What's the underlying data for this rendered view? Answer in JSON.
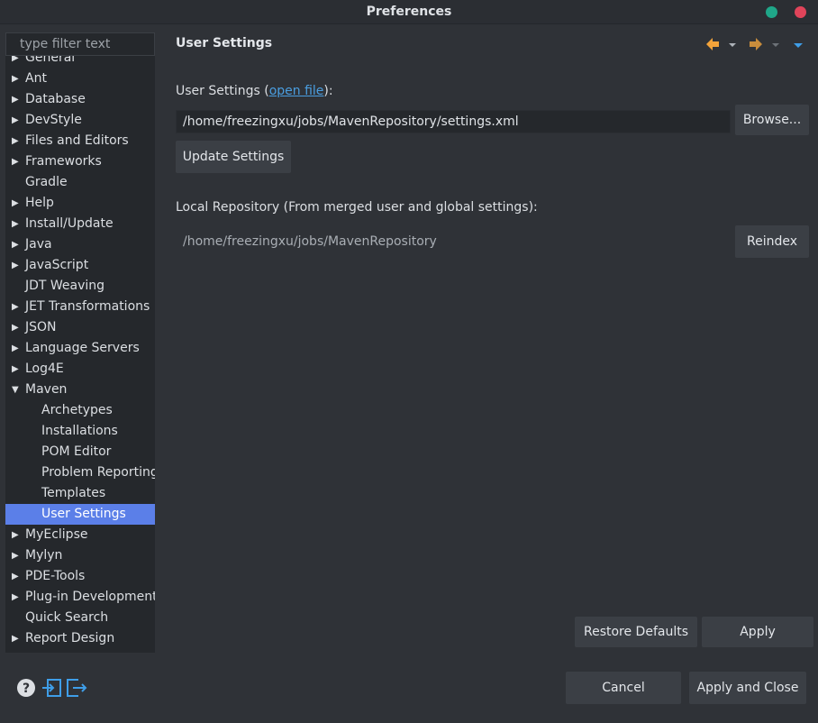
{
  "window": {
    "title": "Preferences"
  },
  "filter": {
    "placeholder": "type filter text"
  },
  "tree": [
    {
      "label": "General",
      "arrow": "▶",
      "child": false
    },
    {
      "label": "Ant",
      "arrow": "▶",
      "child": false
    },
    {
      "label": "Database",
      "arrow": "▶",
      "child": false
    },
    {
      "label": "DevStyle",
      "arrow": "▶",
      "child": false
    },
    {
      "label": "Files and Editors",
      "arrow": "▶",
      "child": false
    },
    {
      "label": "Frameworks",
      "arrow": "▶",
      "child": false
    },
    {
      "label": "Gradle",
      "arrow": "",
      "child": false
    },
    {
      "label": "Help",
      "arrow": "▶",
      "child": false
    },
    {
      "label": "Install/Update",
      "arrow": "▶",
      "child": false
    },
    {
      "label": "Java",
      "arrow": "▶",
      "child": false
    },
    {
      "label": "JavaScript",
      "arrow": "▶",
      "child": false
    },
    {
      "label": "JDT Weaving",
      "arrow": "",
      "child": false
    },
    {
      "label": "JET Transformations",
      "arrow": "▶",
      "child": false
    },
    {
      "label": "JSON",
      "arrow": "▶",
      "child": false
    },
    {
      "label": "Language Servers",
      "arrow": "▶",
      "child": false
    },
    {
      "label": "Log4E",
      "arrow": "▶",
      "child": false
    },
    {
      "label": "Maven",
      "arrow": "▼",
      "child": false
    },
    {
      "label": "Archetypes",
      "arrow": "",
      "child": true
    },
    {
      "label": "Installations",
      "arrow": "",
      "child": true
    },
    {
      "label": "POM Editor",
      "arrow": "",
      "child": true
    },
    {
      "label": "Problem Reporting",
      "arrow": "",
      "child": true
    },
    {
      "label": "Templates",
      "arrow": "",
      "child": true
    },
    {
      "label": "User Settings",
      "arrow": "",
      "child": true,
      "selected": true
    },
    {
      "label": "MyEclipse",
      "arrow": "▶",
      "child": false
    },
    {
      "label": "Mylyn",
      "arrow": "▶",
      "child": false
    },
    {
      "label": "PDE-Tools",
      "arrow": "▶",
      "child": false
    },
    {
      "label": "Plug-in Development",
      "arrow": "▶",
      "child": false
    },
    {
      "label": "Quick Search",
      "arrow": "",
      "child": false
    },
    {
      "label": "Report Design",
      "arrow": "▶",
      "child": false
    }
  ],
  "page": {
    "title": "User Settings",
    "user_settings_label_pre": "User Settings (",
    "user_settings_link": "open file",
    "user_settings_label_post": "):",
    "user_settings_path": "/home/freezingxu/jobs/MavenRepository/settings.xml",
    "browse_label": "Browse...",
    "update_label": "Update Settings",
    "local_repo_label": "Local Repository (From merged user and global settings):",
    "local_repo_path": "/home/freezingxu/jobs/MavenRepository",
    "reindex_label": "Reindex",
    "restore_label": "Restore Defaults",
    "apply_label": "Apply"
  },
  "nav": {
    "back_icon": "arrow-left-icon",
    "forward_icon": "arrow-right-icon",
    "dropdown_glyph": "▾",
    "back_glyph": "🡐",
    "forward_glyph": "🡒"
  },
  "footer": {
    "cancel_label": "Cancel",
    "apply_close_label": "Apply and Close"
  },
  "colors": {
    "background": "#2f3237",
    "tree_background": "#25282c",
    "selection": "#5b7fe8",
    "link": "#4a9ee0",
    "back_arrow": "#f3a33a",
    "menu_arrow": "#3f9ee8"
  }
}
